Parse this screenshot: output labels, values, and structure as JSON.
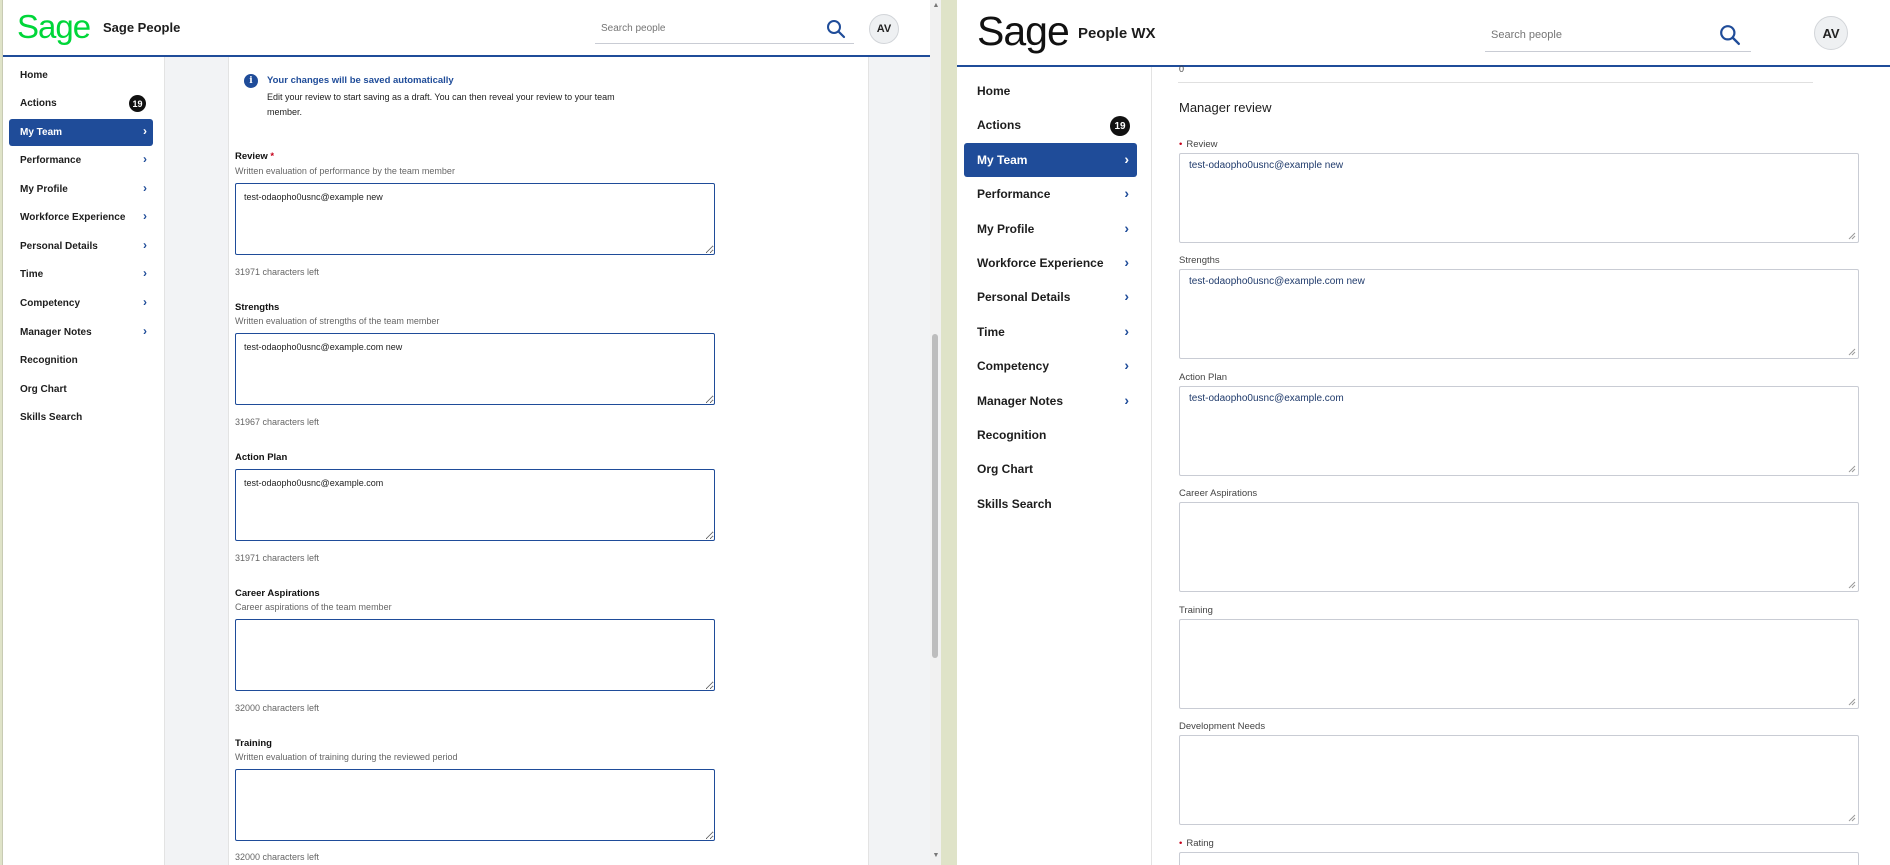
{
  "left": {
    "app_title": "Sage People",
    "logo_text": "Sage",
    "search_placeholder": "Search people",
    "avatar": "AV",
    "nav": [
      {
        "label": "Home",
        "chevron": false
      },
      {
        "label": "Actions",
        "badge": "19"
      },
      {
        "label": "My Team",
        "chevron": true,
        "active": true
      },
      {
        "label": "Performance",
        "chevron": true
      },
      {
        "label": "My Profile",
        "chevron": true
      },
      {
        "label": "Workforce Experience",
        "chevron": true
      },
      {
        "label": "Personal Details",
        "chevron": true
      },
      {
        "label": "Time",
        "chevron": true
      },
      {
        "label": "Competency",
        "chevron": true
      },
      {
        "label": "Manager Notes",
        "chevron": true
      },
      {
        "label": "Recognition"
      },
      {
        "label": "Org Chart"
      },
      {
        "label": "Skills Search"
      }
    ],
    "info": {
      "title": "Your changes will be saved automatically",
      "text": "Edit your review to start saving as a draft. You can then reveal your review to your team member."
    },
    "fields": [
      {
        "label": "Review",
        "required": true,
        "desc": "Written evaluation of performance by the team member",
        "value": "test-odaopho0usnc@example new",
        "count": "31971 characters left"
      },
      {
        "label": "Strengths",
        "desc": "Written evaluation of strengths of the team member",
        "value": "test-odaopho0usnc@example.com new",
        "count": "31967 characters left"
      },
      {
        "label": "Action Plan",
        "desc": "",
        "value": "test-odaopho0usnc@example.com",
        "count": "31971 characters left"
      },
      {
        "label": "Career Aspirations",
        "desc": "Career aspirations of the team member",
        "value": "",
        "count": "32000 characters left"
      },
      {
        "label": "Training",
        "desc": "Written evaluation of training during the reviewed period",
        "value": "",
        "count": "32000 characters left"
      }
    ]
  },
  "right": {
    "app_title": "People WX",
    "logo_text": "Sage",
    "search_placeholder": "Search people",
    "avatar": "AV",
    "nav": [
      {
        "label": "Home"
      },
      {
        "label": "Actions",
        "badge": "19"
      },
      {
        "label": "My Team",
        "chevron": true,
        "active": true
      },
      {
        "label": "Performance",
        "chevron": true
      },
      {
        "label": "My Profile",
        "chevron": true
      },
      {
        "label": "Workforce Experience",
        "chevron": true
      },
      {
        "label": "Personal Details",
        "chevron": true
      },
      {
        "label": "Time",
        "chevron": true
      },
      {
        "label": "Competency",
        "chevron": true
      },
      {
        "label": "Manager Notes",
        "chevron": true
      },
      {
        "label": "Recognition"
      },
      {
        "label": "Org Chart"
      },
      {
        "label": "Skills Search"
      }
    ],
    "partial_value": "0",
    "section_title": "Manager review",
    "fields": [
      {
        "label": "Review",
        "required": true,
        "value": "test-odaopho0usnc@example new"
      },
      {
        "label": "Strengths",
        "value": "test-odaopho0usnc@example.com new"
      },
      {
        "label": "Action Plan",
        "value": "test-odaopho0usnc@example.com"
      },
      {
        "label": "Career Aspirations",
        "value": ""
      },
      {
        "label": "Training",
        "value": ""
      },
      {
        "label": "Development Needs",
        "value": ""
      },
      {
        "label": "Rating",
        "required": true,
        "value": ""
      }
    ]
  },
  "colors": {
    "brand_blue": "#1f4c99",
    "sage_green": "#00d639",
    "required_red": "#c5001a"
  }
}
